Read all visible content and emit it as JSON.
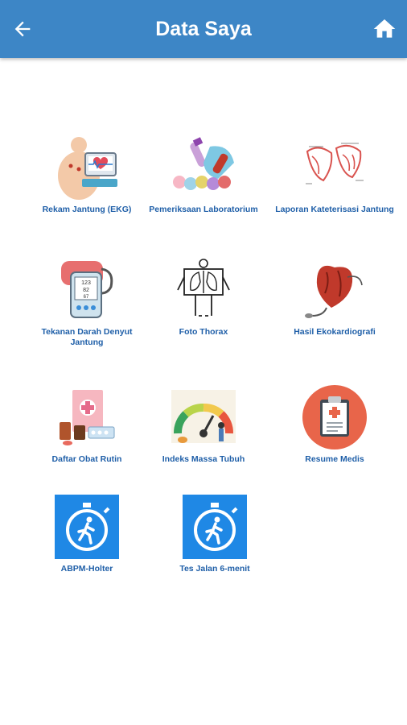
{
  "header": {
    "title": "Data Saya",
    "back_icon": "arrow-left-icon",
    "home_icon": "home-icon",
    "bar_color": "#3d86c6"
  },
  "menu": [
    {
      "label": "Rekam Jantung (EKG)",
      "icon": "ekg-icon"
    },
    {
      "label": "Pemeriksaan Laboratorium",
      "icon": "lab-test-icon"
    },
    {
      "label": "Laporan Kateterisasi Jantung",
      "icon": "catheterization-icon"
    },
    {
      "label": "Tekanan Darah Denyut Jantung",
      "icon": "blood-pressure-icon"
    },
    {
      "label": "Foto Thorax",
      "icon": "xray-icon"
    },
    {
      "label": "Hasil Ekokardiografi",
      "icon": "heart-echo-icon"
    },
    {
      "label": "Daftar Obat Rutin",
      "icon": "medicine-icon"
    },
    {
      "label": "Indeks Massa Tubuh",
      "icon": "bmi-gauge-icon"
    },
    {
      "label": "Resume Medis",
      "icon": "clipboard-icon"
    },
    {
      "label": "ABPM-Holter",
      "icon": "stopwatch-runner-icon"
    },
    {
      "label": "Tes Jalan 6-menit",
      "icon": "stopwatch-runner-icon"
    }
  ],
  "label_color": "#1f5fa8"
}
